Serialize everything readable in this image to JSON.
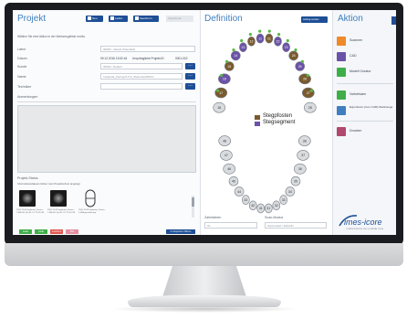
{
  "app": {
    "left_title": "Projekt",
    "mid_title": "Definition",
    "right_title": "Aktion",
    "brand": "imes-icore",
    "brand_tag": "COMPETENCE IN CNC & DENTAL TECH"
  },
  "toolbar": {
    "new_label": "Neu",
    "load_label": "Laden",
    "save_label": "Speichern",
    "delete_label": "Importieren",
    "mid_action_label": "Auftrag senden",
    "colors": {
      "primary": "#1e4f96",
      "disabled": "#e5e8ec"
    }
  },
  "form": {
    "intro": "Wählen Sie eine Aktion in der Werkzeugleiste rechts.",
    "labor_label": "Labor",
    "labor_value": "00000 •   default (Standard)",
    "datum_label": "Datum",
    "datum_value": "09.12.2016  13:52:44",
    "original_id_label": "Ursprüngliche Projekt-ID",
    "original_id_value": "0001-002",
    "kunde_label": "Kunde",
    "kunde_value": "00000 •   Default",
    "name_label": "Name",
    "name_value": "Implantat_Zentrgr/4-5-6_SteamstarRNKN",
    "techniker_label": "Techniker",
    "anmerkungen_label": "Anmerkungen",
    "more_button": "…"
  },
  "status": {
    "title": "Projekt-Status",
    "subtitle": "Informationsdateien fehlen: kein Projektordner angelegt",
    "files": [
      {
        "caption": "2016-12-09 Implantat_Zentro... 7.90E-09 Ty1-S1-C1-T1-S1-1N"
      },
      {
        "caption": "2016-12-09 Implantat_Zentro... 7.90E-09 Ty1-S1-C1-T1-S1-1N"
      },
      {
        "caption": "2016-12-09 Implantat_Zentro... 1-SB8-gewinde.dep"
      }
    ],
    "buttons": [
      {
        "label": "Lade",
        "color": "#3fae49"
      },
      {
        "label": "Lade",
        "color": "#3fae49"
      },
      {
        "label": "Löschen",
        "color": "#e0584f"
      },
      {
        "label": "Alle",
        "color": "#e48fa0"
      }
    ],
    "explorer_button": "im Explorer öffnen"
  },
  "definition": {
    "legend": [
      {
        "label": "Stegpfosten",
        "color": "#7a5a2e"
      },
      {
        "label": "Stegsegment",
        "color": "#6b52a8"
      }
    ],
    "zahnfarben_label": "Zahnfarben",
    "zahnfarben_value": "A1",
    "scan_modus_label": "Scan-Modus",
    "scan_modus_value": "Gipsmodell / Zahnfilm",
    "upper_numbers": [
      "18",
      "17",
      "16",
      "15",
      "14",
      "13",
      "12",
      "11",
      "21",
      "22",
      "23",
      "24",
      "25",
      "26",
      "27",
      "28"
    ],
    "lower_numbers": [
      "48",
      "47",
      "46",
      "45",
      "44",
      "43",
      "42",
      "41",
      "31",
      "32",
      "33",
      "34",
      "35",
      "36",
      "37",
      "38"
    ],
    "post_color": "#7a5a2e",
    "segment_color": "#6b52a8",
    "tooth_color": "#d9dcdf",
    "dot_color": "#58b848"
  },
  "actions": [
    {
      "label": "Scannen",
      "color": "#f0892a"
    },
    {
      "label": "CAD",
      "color": "#6b52a8"
    },
    {
      "label": "Modell Creator",
      "color": "#3fae49"
    },
    {
      "label": "Vorbehlaen",
      "color": "#3fae49"
    },
    {
      "label": "Exportieren (zum CAM) Werkzeuge",
      "color": "#3f7fbf"
    },
    {
      "label": "Drucken",
      "color": "#b1486e"
    }
  ]
}
